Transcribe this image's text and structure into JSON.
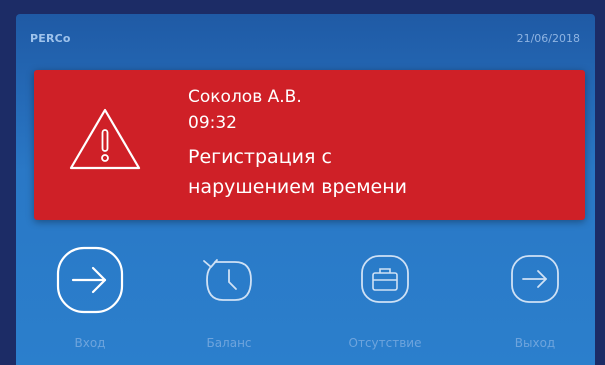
{
  "header": {
    "logo": "PERCo",
    "date": "21/06/2018"
  },
  "alert": {
    "name": "Соколов А.В.",
    "time": "09:32",
    "message_line1": "Регистрация с",
    "message_line2": "нарушением времени",
    "icon": "warning-icon",
    "color": "#cf2027"
  },
  "actions": [
    {
      "label": "Вход",
      "icon": "enter-icon",
      "active": true
    },
    {
      "label": "Баланс",
      "icon": "history-clock-icon",
      "active": false
    },
    {
      "label": "Отсутствие",
      "icon": "briefcase-icon",
      "active": false
    },
    {
      "label": "Выход",
      "icon": "exit-icon",
      "active": false
    }
  ]
}
